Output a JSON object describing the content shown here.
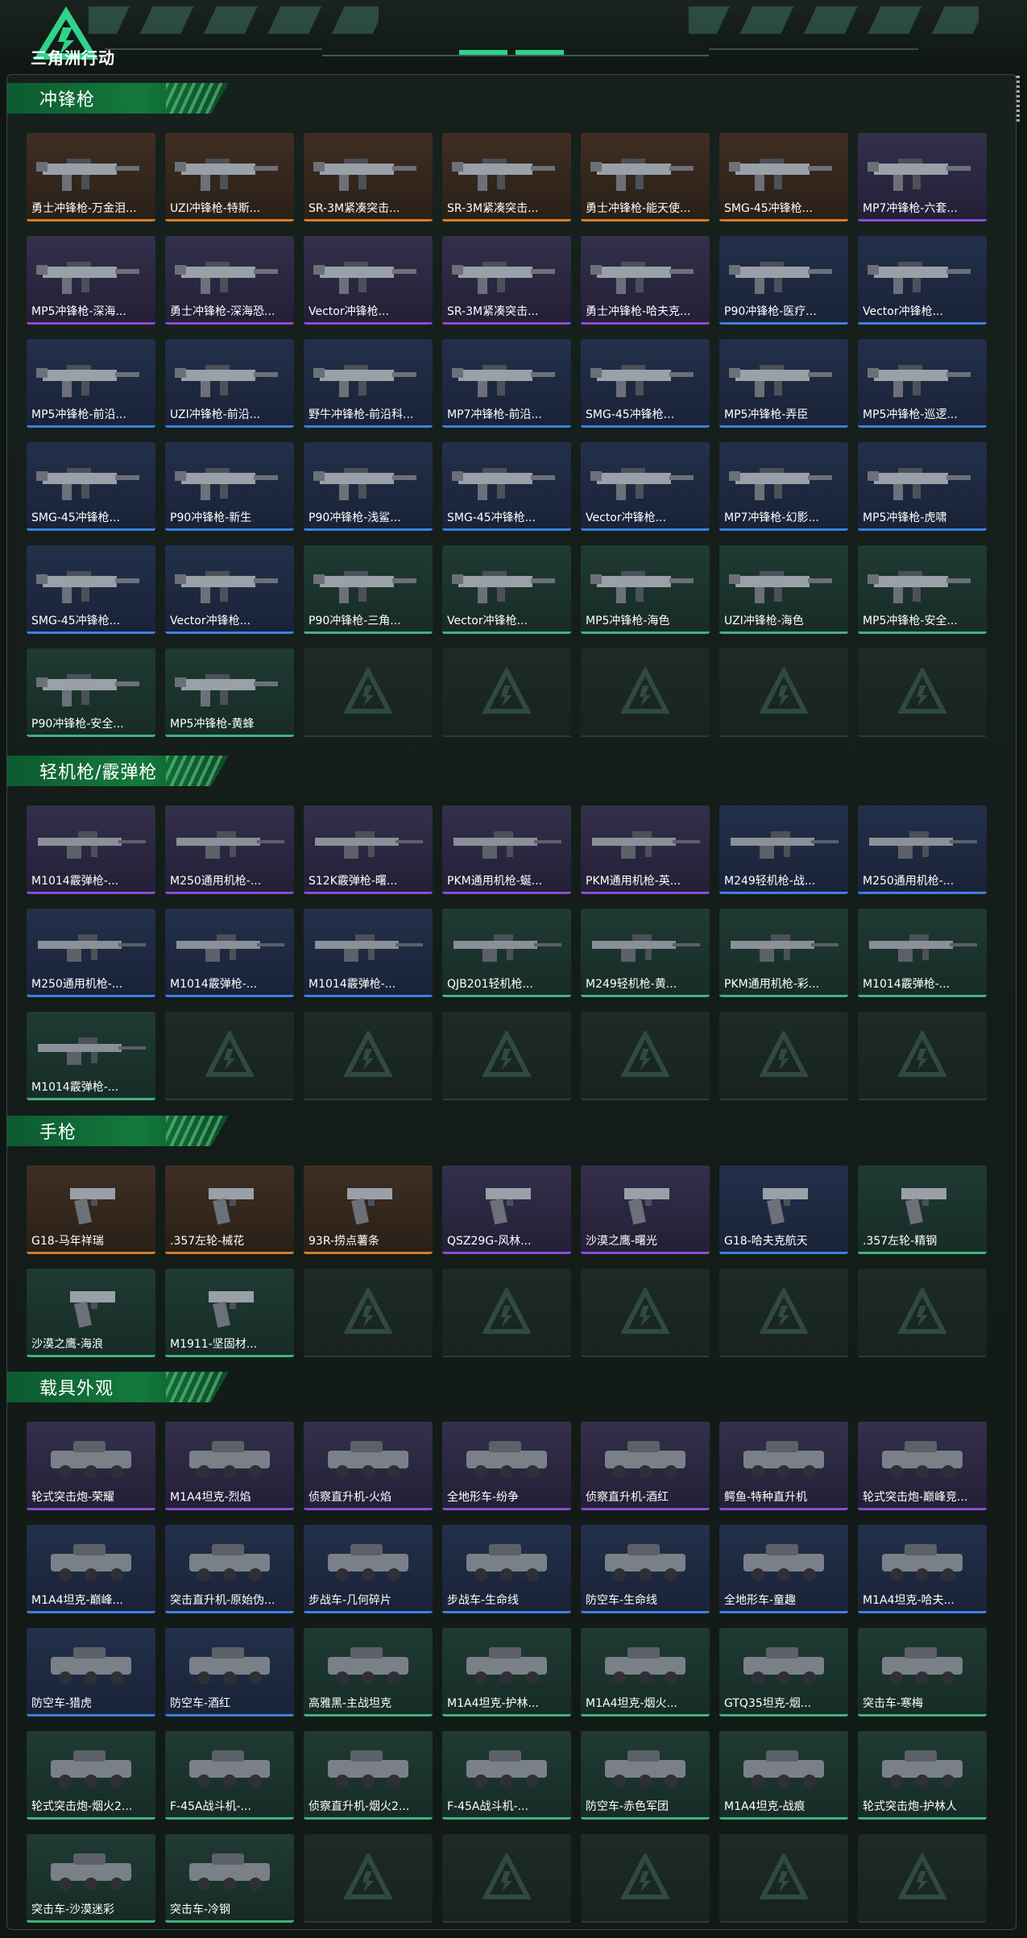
{
  "app": {
    "title": "三角洲行动"
  },
  "colors": {
    "accent_green": "#2fd38a",
    "section_green": "#147a3d",
    "quality_orange": "#d77a28",
    "quality_purple": "#8a4bd8",
    "quality_blue": "#3c7fe0",
    "quality_green": "#3fb37a"
  },
  "sections": [
    {
      "title": "冲锋枪",
      "items": [
        {
          "label": "勇士冲锋枪-万金泪...",
          "quality": "orange",
          "icon": "smg"
        },
        {
          "label": "UZI冲锋枪-特斯...",
          "quality": "orange",
          "icon": "smg"
        },
        {
          "label": "SR-3M紧凑突击...",
          "quality": "orange",
          "icon": "smg"
        },
        {
          "label": "SR-3M紧凑突击...",
          "quality": "orange",
          "icon": "smg"
        },
        {
          "label": "勇士冲锋枪-能天使...",
          "quality": "orange",
          "icon": "smg"
        },
        {
          "label": "SMG-45冲锋枪...",
          "quality": "orange",
          "icon": "smg"
        },
        {
          "label": "MP7冲锋枪-六套...",
          "quality": "purple",
          "icon": "smg"
        },
        {
          "label": "MP5冲锋枪-深海...",
          "quality": "purple",
          "icon": "smg"
        },
        {
          "label": "勇士冲锋枪-深海恐...",
          "quality": "purple",
          "icon": "smg"
        },
        {
          "label": "Vector冲锋枪...",
          "quality": "purple",
          "icon": "smg"
        },
        {
          "label": "SR-3M紧凑突击...",
          "quality": "purple",
          "icon": "smg"
        },
        {
          "label": "勇士冲锋枪-哈夫克...",
          "quality": "purple",
          "icon": "smg"
        },
        {
          "label": "P90冲锋枪-医疗...",
          "quality": "blue",
          "icon": "smg"
        },
        {
          "label": "Vector冲锋枪...",
          "quality": "blue",
          "icon": "smg"
        },
        {
          "label": "MP5冲锋枪-前沿...",
          "quality": "blue",
          "icon": "smg"
        },
        {
          "label": "UZI冲锋枪-前沿...",
          "quality": "blue",
          "icon": "smg"
        },
        {
          "label": "野牛冲锋枪-前沿科...",
          "quality": "blue",
          "icon": "smg"
        },
        {
          "label": "MP7冲锋枪-前沿...",
          "quality": "blue",
          "icon": "smg"
        },
        {
          "label": "SMG-45冲锋枪...",
          "quality": "blue",
          "icon": "smg"
        },
        {
          "label": "MP5冲锋枪-弄臣",
          "quality": "blue",
          "icon": "smg"
        },
        {
          "label": "MP5冲锋枪-巡逻...",
          "quality": "blue",
          "icon": "smg"
        },
        {
          "label": "SMG-45冲锋枪...",
          "quality": "blue",
          "icon": "smg"
        },
        {
          "label": "P90冲锋枪-新生",
          "quality": "blue",
          "icon": "smg"
        },
        {
          "label": "P90冲锋枪-浅鲨...",
          "quality": "blue",
          "icon": "smg"
        },
        {
          "label": "SMG-45冲锋枪...",
          "quality": "blue",
          "icon": "smg"
        },
        {
          "label": "Vector冲锋枪...",
          "quality": "blue",
          "icon": "smg"
        },
        {
          "label": "MP7冲锋枪-幻影...",
          "quality": "blue",
          "icon": "smg"
        },
        {
          "label": "MP5冲锋枪-虎啸",
          "quality": "blue",
          "icon": "smg"
        },
        {
          "label": "SMG-45冲锋枪...",
          "quality": "blue",
          "icon": "smg"
        },
        {
          "label": "Vector冲锋枪...",
          "quality": "blue",
          "icon": "smg"
        },
        {
          "label": "P90冲锋枪-三角...",
          "quality": "green",
          "icon": "smg"
        },
        {
          "label": "Vector冲锋枪...",
          "quality": "green",
          "icon": "smg"
        },
        {
          "label": "MP5冲锋枪-海色",
          "quality": "green",
          "icon": "smg"
        },
        {
          "label": "UZI冲锋枪-海色",
          "quality": "green",
          "icon": "smg"
        },
        {
          "label": "MP5冲锋枪-安全...",
          "quality": "green",
          "icon": "smg"
        },
        {
          "label": "P90冲锋枪-安全...",
          "quality": "green",
          "icon": "smg"
        },
        {
          "label": "MP5冲锋枪-黄蜂",
          "quality": "green",
          "icon": "smg"
        }
      ],
      "empty_slots": 5
    },
    {
      "title": "轻机枪/霰弹枪",
      "items": [
        {
          "label": "M1014霰弹枪-...",
          "quality": "purple",
          "icon": "lmg"
        },
        {
          "label": "M250通用机枪-...",
          "quality": "purple",
          "icon": "lmg"
        },
        {
          "label": "S12K霰弹枪-曙...",
          "quality": "purple",
          "icon": "lmg"
        },
        {
          "label": "PKM通用机枪-蜒...",
          "quality": "purple",
          "icon": "lmg"
        },
        {
          "label": "PKM通用机枪-英...",
          "quality": "purple",
          "icon": "lmg"
        },
        {
          "label": "M249轻机枪-战...",
          "quality": "blue",
          "icon": "lmg"
        },
        {
          "label": "M250通用机枪-...",
          "quality": "blue",
          "icon": "lmg"
        },
        {
          "label": "M250通用机枪-...",
          "quality": "blue",
          "icon": "lmg"
        },
        {
          "label": "M1014霰弹枪-...",
          "quality": "blue",
          "icon": "lmg"
        },
        {
          "label": "M1014霰弹枪-...",
          "quality": "blue",
          "icon": "lmg"
        },
        {
          "label": "QJB201轻机枪...",
          "quality": "green",
          "icon": "lmg"
        },
        {
          "label": "M249轻机枪-黄...",
          "quality": "green",
          "icon": "lmg"
        },
        {
          "label": "PKM通用机枪-彩...",
          "quality": "green",
          "icon": "lmg"
        },
        {
          "label": "M1014霰弹枪-...",
          "quality": "green",
          "icon": "lmg"
        },
        {
          "label": "M1014霰弹枪-...",
          "quality": "green",
          "icon": "lmg"
        }
      ],
      "empty_slots": 6
    },
    {
      "title": "手枪",
      "items": [
        {
          "label": "G18-马年祥瑞",
          "quality": "orange",
          "icon": "pistol"
        },
        {
          "label": ".357左轮-械花",
          "quality": "orange",
          "icon": "pistol"
        },
        {
          "label": "93R-捞点薯条",
          "quality": "orange",
          "icon": "pistol"
        },
        {
          "label": "QSZ29G-风林...",
          "quality": "purple",
          "icon": "pistol"
        },
        {
          "label": "沙漠之鹰-曙光",
          "quality": "purple",
          "icon": "pistol"
        },
        {
          "label": "G18-哈夫克航天",
          "quality": "blue",
          "icon": "pistol"
        },
        {
          "label": ".357左轮-精钢",
          "quality": "green",
          "icon": "pistol"
        },
        {
          "label": "沙漠之鹰-海浪",
          "quality": "green",
          "icon": "pistol"
        },
        {
          "label": "M1911-坚固材...",
          "quality": "green",
          "icon": "pistol"
        }
      ],
      "empty_slots": 5
    },
    {
      "title": "载具外观",
      "items": [
        {
          "label": "轮式突击炮-荣耀",
          "quality": "purple",
          "icon": "vehicle"
        },
        {
          "label": "M1A4坦克-烈焰",
          "quality": "purple",
          "icon": "vehicle"
        },
        {
          "label": "侦察直升机-火焰",
          "quality": "purple",
          "icon": "vehicle"
        },
        {
          "label": "全地形车-纷争",
          "quality": "purple",
          "icon": "vehicle"
        },
        {
          "label": "侦察直升机-酒红",
          "quality": "purple",
          "icon": "vehicle"
        },
        {
          "label": "鳄鱼-特种直升机",
          "quality": "purple",
          "icon": "vehicle"
        },
        {
          "label": "轮式突击炮-巅峰竞...",
          "quality": "purple",
          "icon": "vehicle"
        },
        {
          "label": "M1A4坦克-巅峰...",
          "quality": "blue",
          "icon": "vehicle"
        },
        {
          "label": "突击直升机-原始伪...",
          "quality": "blue",
          "icon": "vehicle"
        },
        {
          "label": "步战车-几何碎片",
          "quality": "blue",
          "icon": "vehicle"
        },
        {
          "label": "步战车-生命线",
          "quality": "blue",
          "icon": "vehicle"
        },
        {
          "label": "防空车-生命线",
          "quality": "blue",
          "icon": "vehicle"
        },
        {
          "label": "全地形车-童趣",
          "quality": "blue",
          "icon": "vehicle"
        },
        {
          "label": "M1A4坦克-哈夫...",
          "quality": "blue",
          "icon": "vehicle"
        },
        {
          "label": "防空车-猎虎",
          "quality": "blue",
          "icon": "vehicle"
        },
        {
          "label": "防空车-酒红",
          "quality": "blue",
          "icon": "vehicle"
        },
        {
          "label": "高雅黑-主战坦克",
          "quality": "green",
          "icon": "vehicle"
        },
        {
          "label": "M1A4坦克-护林...",
          "quality": "green",
          "icon": "vehicle"
        },
        {
          "label": "M1A4坦克-烟火...",
          "quality": "green",
          "icon": "vehicle"
        },
        {
          "label": "GTQ35坦克-烟...",
          "quality": "green",
          "icon": "vehicle"
        },
        {
          "label": "突击车-寒梅",
          "quality": "green",
          "icon": "vehicle"
        },
        {
          "label": "轮式突击炮-烟火2...",
          "quality": "green",
          "icon": "vehicle"
        },
        {
          "label": "F-45A战斗机-...",
          "quality": "green",
          "icon": "vehicle"
        },
        {
          "label": "侦察直升机-烟火2...",
          "quality": "green",
          "icon": "vehicle"
        },
        {
          "label": "F-45A战斗机-...",
          "quality": "green",
          "icon": "vehicle"
        },
        {
          "label": "防空车-赤色军团",
          "quality": "green",
          "icon": "vehicle"
        },
        {
          "label": "M1A4坦克-战痕",
          "quality": "green",
          "icon": "vehicle"
        },
        {
          "label": "轮式突击炮-护林人",
          "quality": "green",
          "icon": "vehicle"
        },
        {
          "label": "突击车-沙漠迷彩",
          "quality": "green",
          "icon": "vehicle"
        },
        {
          "label": "突击车-冷钢",
          "quality": "green",
          "icon": "vehicle"
        }
      ],
      "empty_slots": 5
    }
  ]
}
